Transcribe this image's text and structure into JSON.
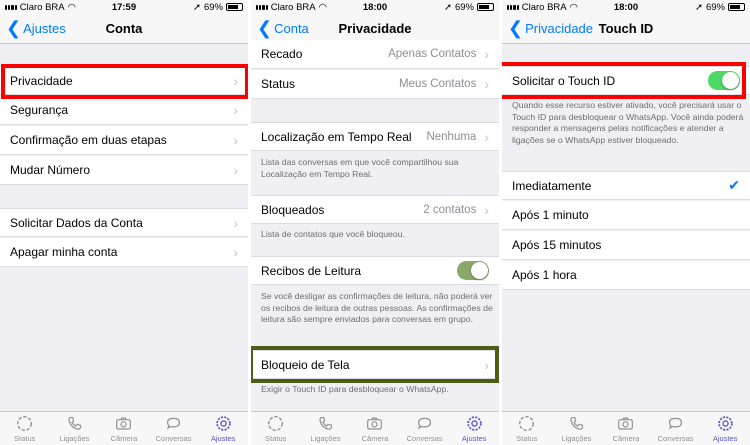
{
  "status": [
    {
      "carrier": "Claro BRA",
      "time": "17:59",
      "battery": "69%"
    },
    {
      "carrier": "Claro BRA",
      "time": "18:00",
      "battery": "69%"
    },
    {
      "carrier": "Claro BRA",
      "time": "18:00",
      "battery": "69%"
    }
  ],
  "screen1": {
    "back": "Ajustes",
    "title": "Conta",
    "items": [
      "Privacidade",
      "Segurança",
      "Confirmação em duas etapas",
      "Mudar Número",
      "Solicitar Dados da Conta",
      "Apagar minha conta"
    ]
  },
  "screen2": {
    "back": "Conta",
    "title": "Privacidade",
    "recado": {
      "label": "Recado",
      "value": "Apenas Contatos"
    },
    "status_row": {
      "label": "Status",
      "value": "Meus Contatos"
    },
    "localizacao": {
      "label": "Localização em Tempo Real",
      "value": "Nenhuma",
      "footer": "Lista das conversas em que você compartilhou sua Localização em Tempo Real."
    },
    "bloqueados": {
      "label": "Bloqueados",
      "value": "2 contatos",
      "footer": "Lista de contatos que você bloqueou."
    },
    "recibos": {
      "label": "Recibos de Leitura",
      "on": true,
      "footer": "Se você desligar as confirmações de leitura, não poderá ver os recibos de leitura de outras pessoas. As confirmações de leitura são sempre enviados para conversas em grupo."
    },
    "bloqueio": {
      "label": "Bloqueio de Tela",
      "footer": "Exigir o Touch ID para desbloquear o WhatsApp."
    }
  },
  "screen3": {
    "back": "Privacidade",
    "title": "Touch ID",
    "touch": {
      "label": "Solicitar o Touch ID",
      "on": true
    },
    "footer": "Quando esse recurso estiver ativado, você precisará usar o Touch ID para desbloquear o WhatsApp. Você ainda poderá responder a mensagens pelas notificações e atender a ligações se o WhatsApp estiver bloqueado.",
    "options": [
      "Imediatamente",
      "Após 1 minuto",
      "Após 15 minutos",
      "Após 1 hora"
    ],
    "selected": "Imediatamente"
  },
  "tabs": [
    {
      "label": "Status",
      "icon": "status-icon"
    },
    {
      "label": "Ligações",
      "icon": "phone-icon"
    },
    {
      "label": "Câmera",
      "icon": "camera-icon"
    },
    {
      "label": "Conversas",
      "icon": "chats-icon"
    },
    {
      "label": "Ajustes",
      "icon": "gear-icon"
    }
  ],
  "colors": {
    "accent": "#007aff",
    "active_tab": "#5856d6",
    "toggle_recibos": "#8aa868",
    "toggle_touch": "#4cd964",
    "highlight_red": "#ff0000",
    "highlight_olive": "#4b5d16"
  }
}
